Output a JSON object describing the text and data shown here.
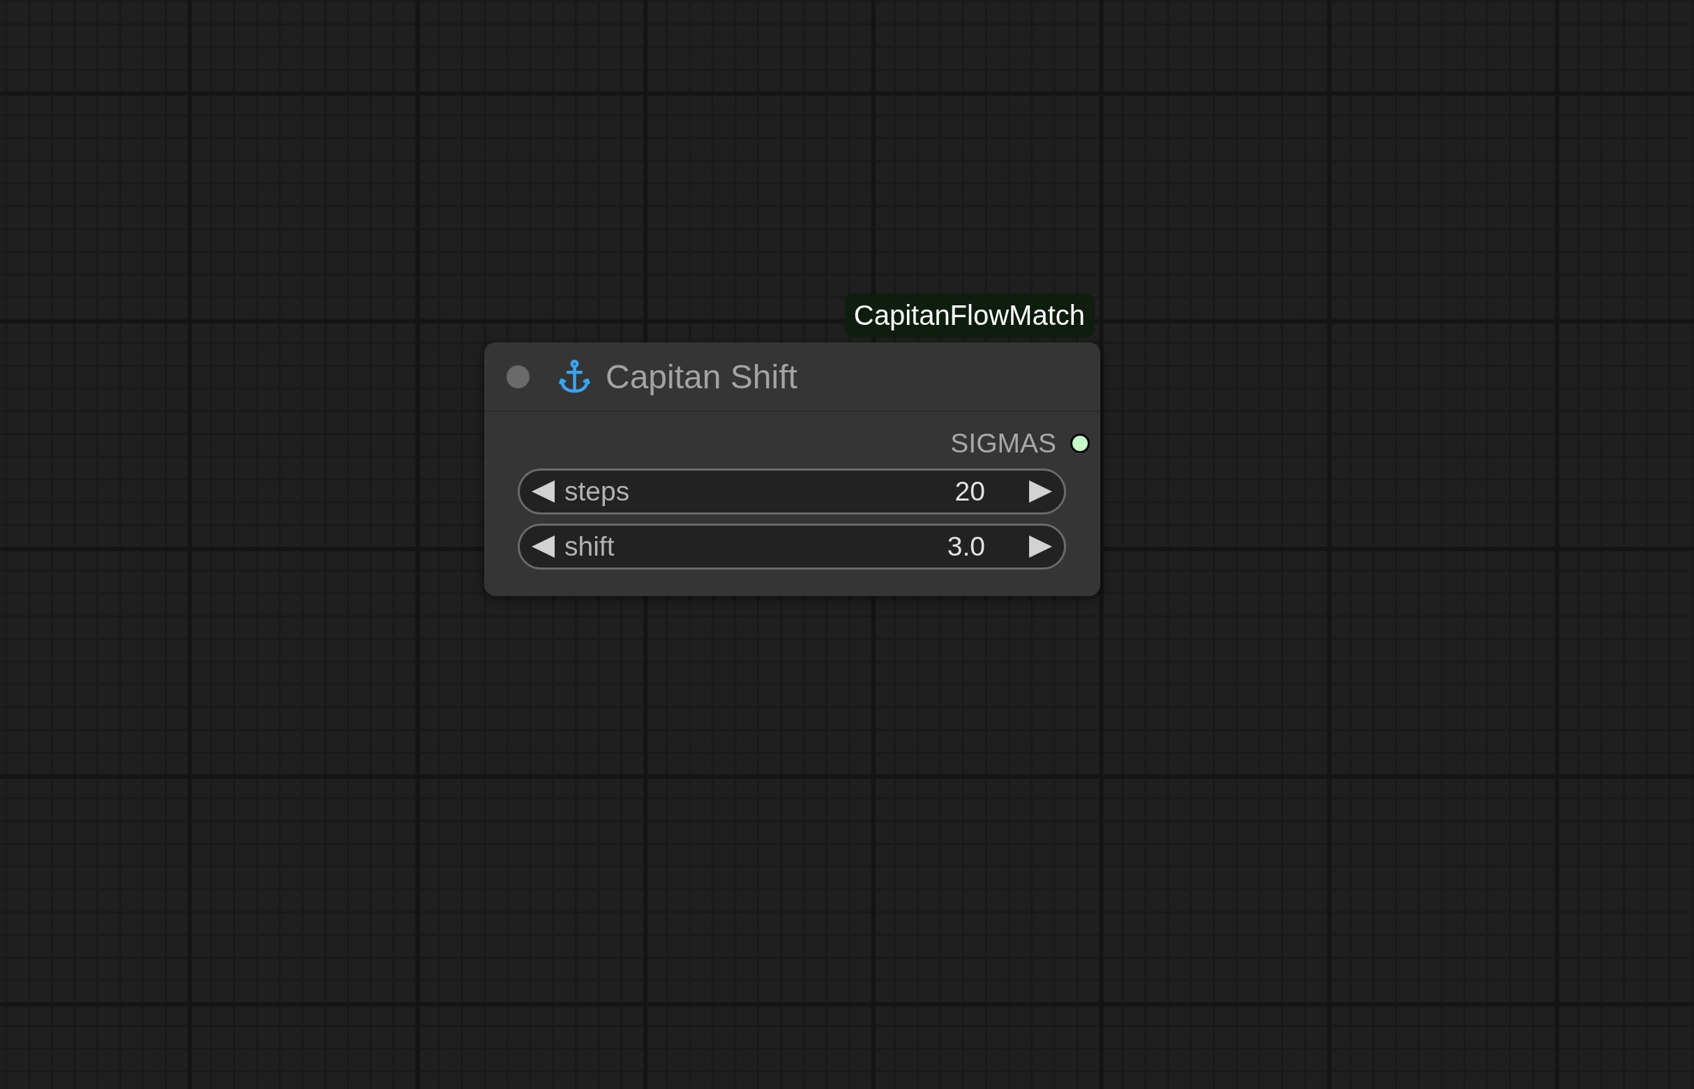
{
  "node": {
    "badge": "CapitanFlowMatch",
    "title": "Capitan Shift",
    "outputs": [
      {
        "label": "SIGMAS",
        "color": "#c8f7c8"
      }
    ],
    "widgets": [
      {
        "label": "steps",
        "value": "20"
      },
      {
        "label": "shift",
        "value": "3.0"
      }
    ]
  }
}
